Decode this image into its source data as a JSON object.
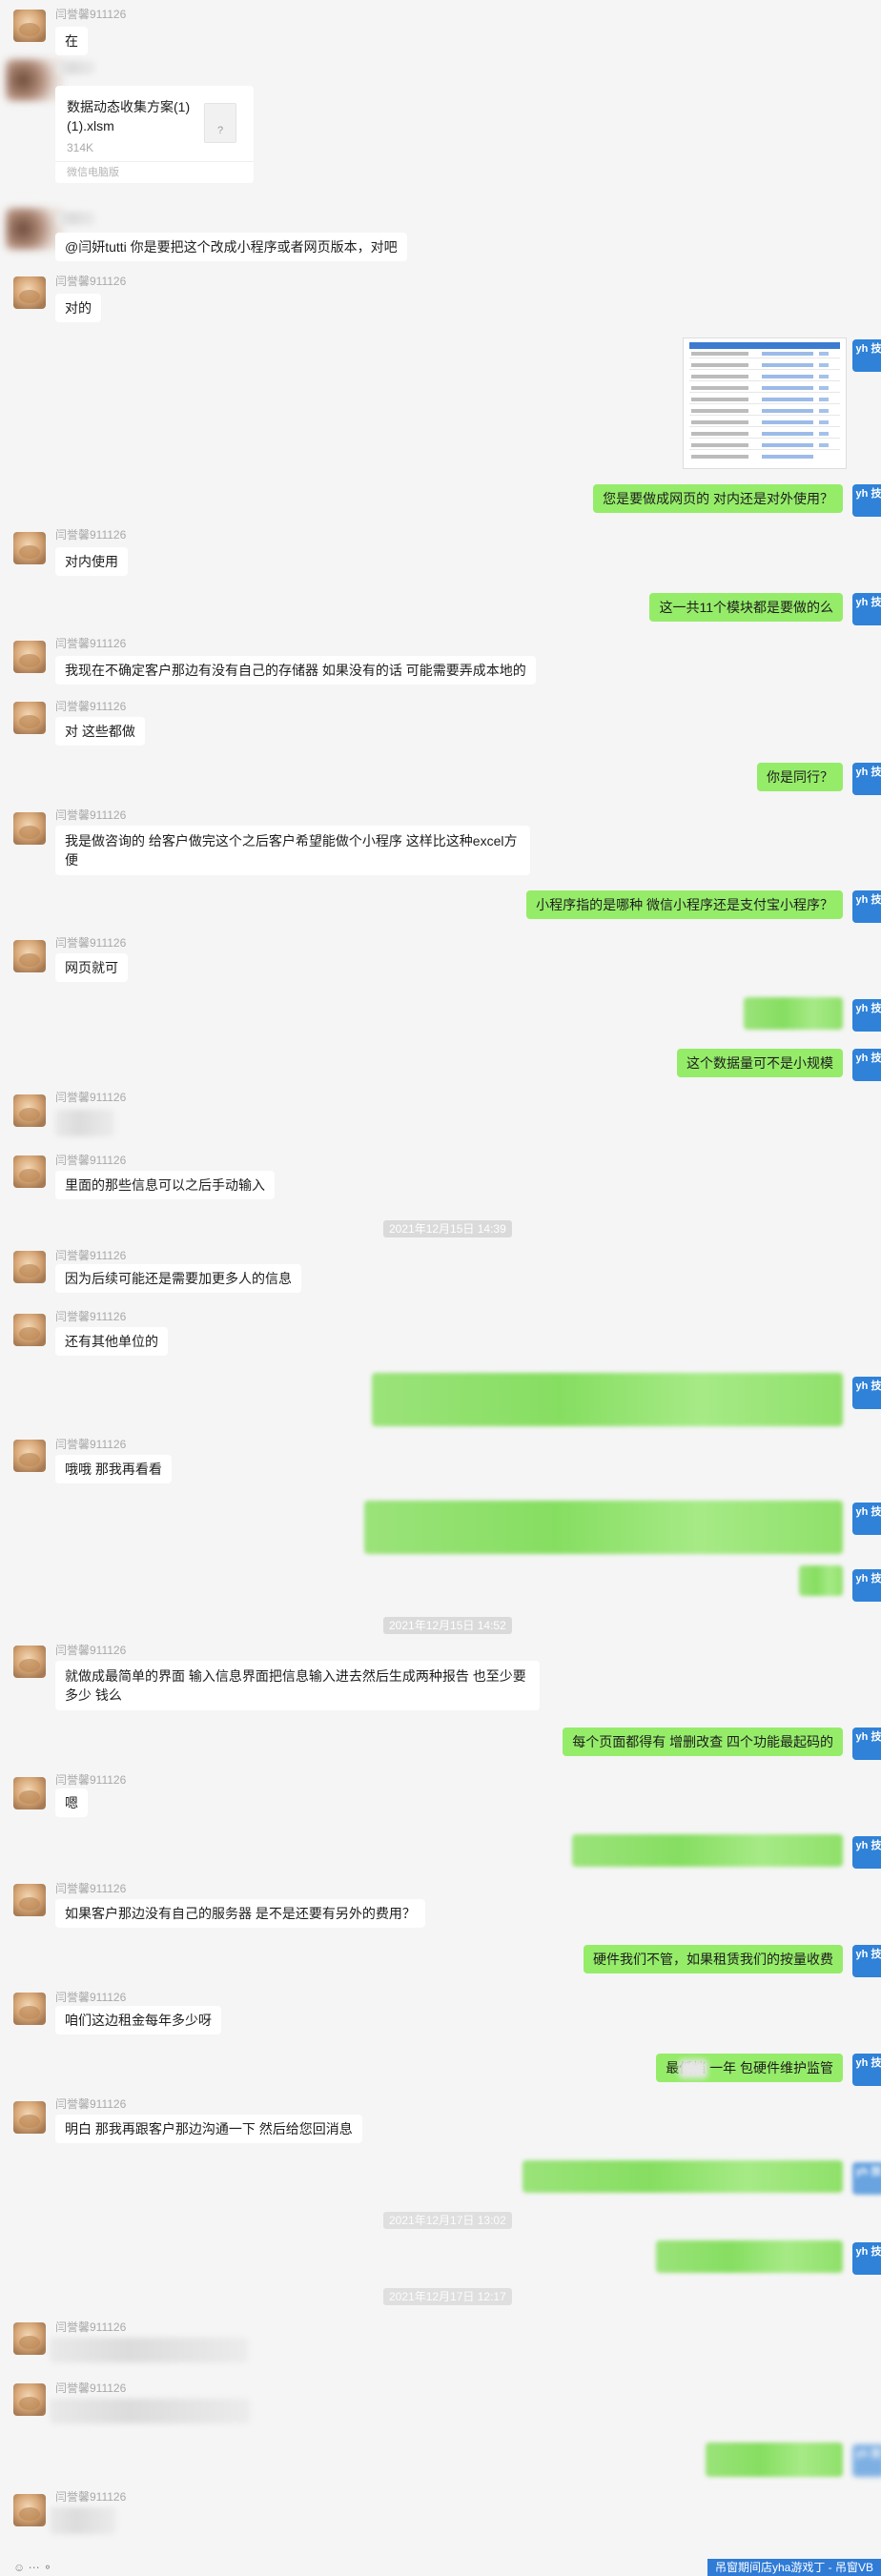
{
  "sender_name": "闫誉馨911126",
  "messages": {
    "m1": "在",
    "file": {
      "name": "数据动态收集方案(1)(1).xlsm",
      "size": "314K",
      "source": "微信电脑版",
      "icon_label": "?"
    },
    "m2": "@闫妍tutti 你是要把这个改成小程序或者网页版本，对吧",
    "m3": "对的",
    "m4": "您是要做成网页的  对内还是对外使用？",
    "m5": "对内使用",
    "m6": "这一共11个模块都是要做的么",
    "m7": "我现在不确定客户那边有没有自己的存储器 如果没有的话 可能需要弄成本地的",
    "m8": "对 这些都做",
    "m9": "你是同行？",
    "m10": "我是做咨询的 给客户做完这个之后客户希望能做个小程序 这样比这种excel方便",
    "m11": "小程序指的是哪种 微信小程序还是支付宝小程序？",
    "m12": "网页就可",
    "m13": "这个数据量可不是小规模",
    "m14": "里面的那些信息可以之后手动输入",
    "t1": "2021年12月15日 14:39",
    "m15": "因为后续可能还是需要加更多人的信息",
    "m16": "还有其他单位的",
    "m17": "哦哦 那我再看看",
    "t2": "2021年12月15日 14:52",
    "m18": "就做成最简单的界面 输入信息界面把信息输入进去然后生成两种报告 也至少要多少  钱么",
    "m19": "每个页面都得有 增删改查  四个功能最起码的",
    "m20": "嗯",
    "m21": "如果客户那边没有自己的服务器 是不是还要有另外的费用？",
    "m22": "硬件我们不管，如果租赁我们的按量收费",
    "m23": "咱们这边租金每年多少呀",
    "m24": "最低档      一年  包硬件维护监管",
    "m25": "明白 那我再跟客户那边沟通一下 然后给您回消息",
    "t3": "2021年12月17日 13:02",
    "t4": "2021年12月17日 12:17"
  },
  "me_avatar_label": "yh 技",
  "footer": {
    "badge": "吊窗期间店yha游戏丁 - 吊窗VB",
    "icons": "☺  ⋯  ⚬"
  },
  "colors": {
    "bg": "#f5f5f5",
    "mine": "#95ec69",
    "theirs": "#ffffff",
    "avatar_me": "#2f82d8"
  }
}
